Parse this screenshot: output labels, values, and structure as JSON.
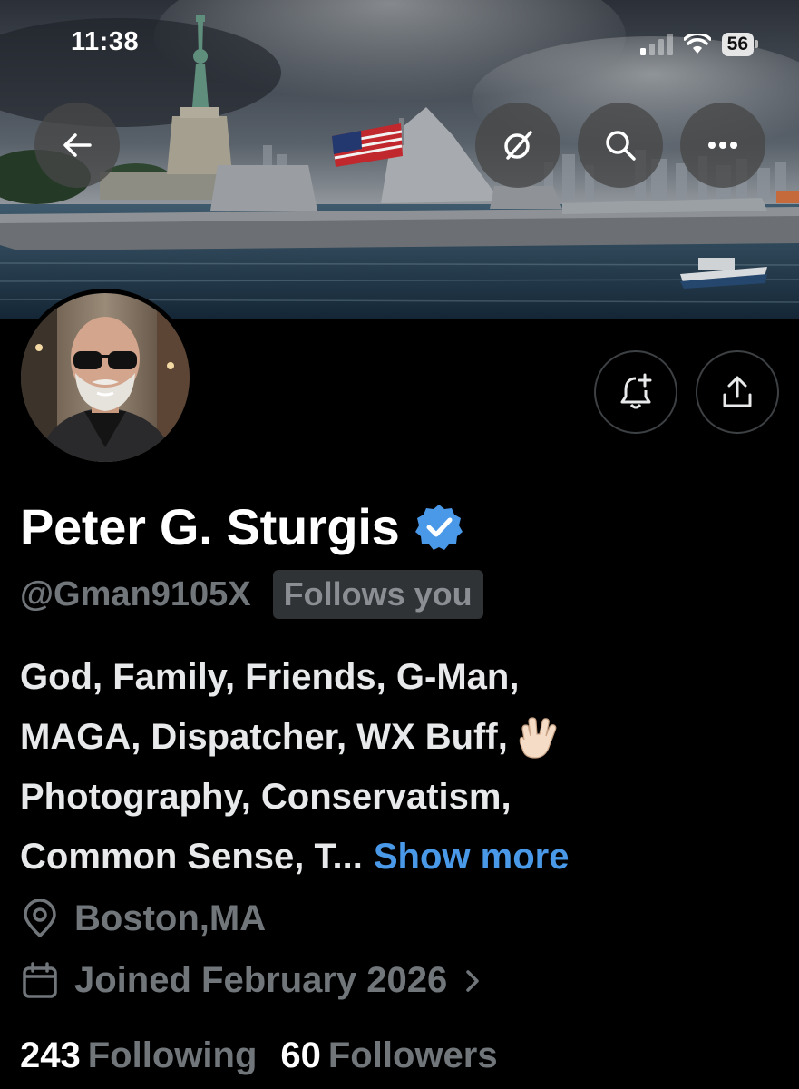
{
  "status_bar": {
    "time": "11:38",
    "battery": "56"
  },
  "profile": {
    "name": "Peter G. Sturgis",
    "handle": "@Gman9105X",
    "follows_you": "Follows you",
    "bio_lines": [
      "God, Family, Friends, G-Man,",
      "MAGA, Dispatcher, WX Buff,",
      "Photography, Conservatism,",
      "Common Sense, T..."
    ],
    "show_more": "Show more",
    "location": "Boston,MA",
    "joined": "Joined February 2026",
    "following_count": "243",
    "following_label": "Following",
    "followers_count": "60",
    "followers_label": "Followers"
  },
  "icons": [
    "back-arrow-icon",
    "grok-icon",
    "search-icon",
    "more-icon",
    "notification-bell-plus-icon",
    "share-icon",
    "verified-badge-icon",
    "location-pin-icon",
    "calendar-icon",
    "chevron-right-icon",
    "vulcan-salute-emoji"
  ],
  "colors": {
    "background": "#000000",
    "verified_blue": "#4a99e9",
    "link_blue": "#4a99e9",
    "secondary_text": "#71767b",
    "primary_text": "#e7e9ea"
  }
}
